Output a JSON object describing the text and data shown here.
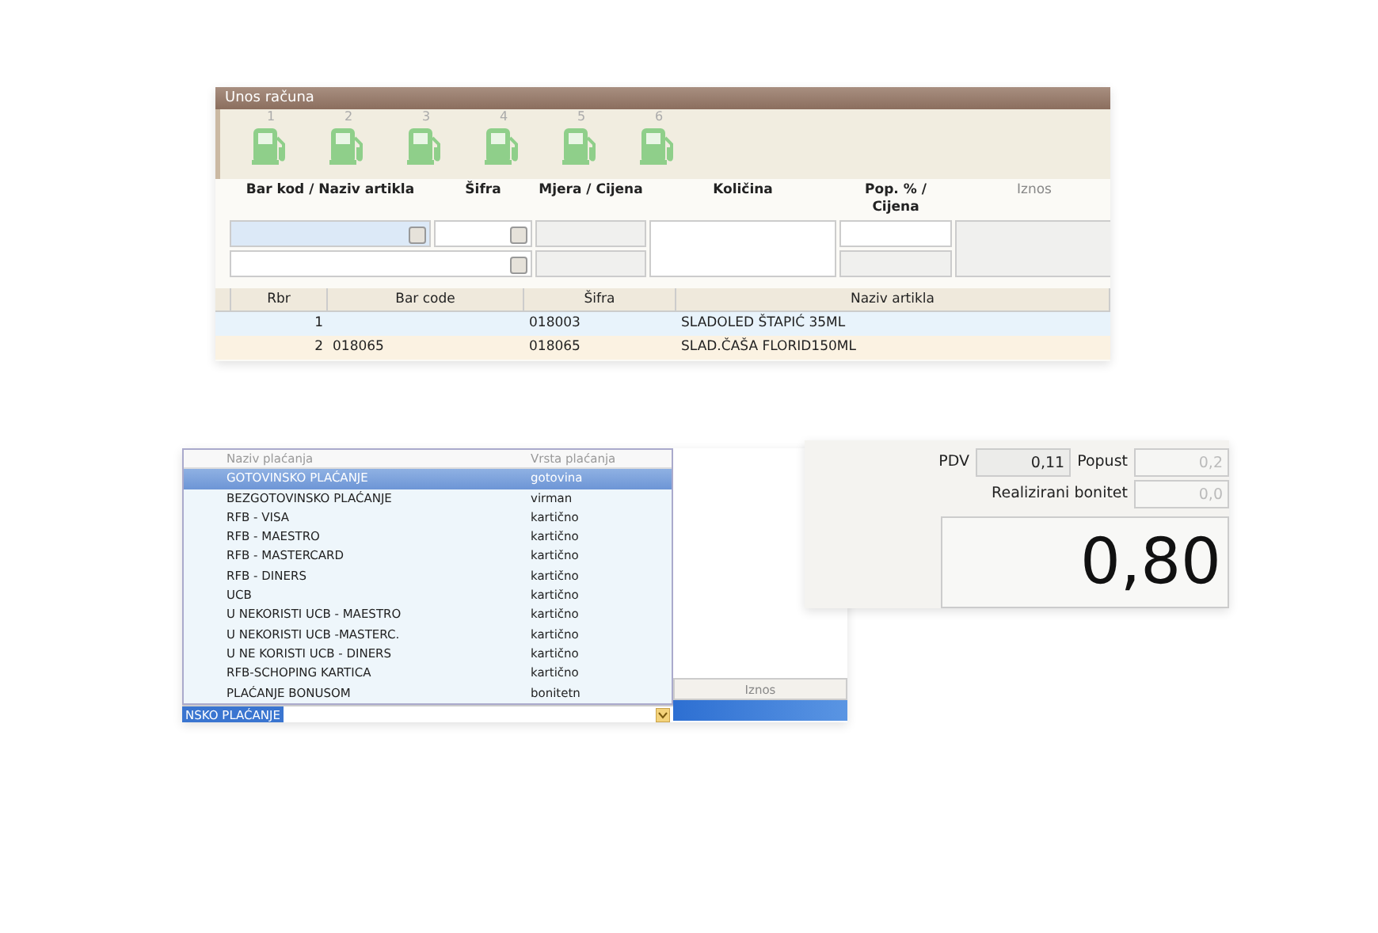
{
  "window": {
    "title": "Unos računa"
  },
  "pumps": [
    {
      "label": "1"
    },
    {
      "label": "2"
    },
    {
      "label": "3"
    },
    {
      "label": "4"
    },
    {
      "label": "5"
    },
    {
      "label": "6"
    }
  ],
  "entry_form": {
    "columns": [
      "Bar kod / Naziv artikla",
      "Šifra",
      "Mjera / Cijena",
      "Količina",
      "Pop. %  /  Cijena",
      "Iznos"
    ]
  },
  "items_table": {
    "columns": [
      "Rbr",
      "Bar code",
      "Šifra",
      "Naziv artikla"
    ],
    "rows": [
      {
        "rbr": "1",
        "sifra": "018003",
        "naziv": "SLADOLED ŠTAPIĆ 35ML",
        "selected": true
      },
      {
        "rbr": "2",
        "bar_code": "018065",
        "sifra": "018065",
        "naziv": "SLAD.ČAŠA FLORID150ML",
        "selected": false
      }
    ]
  },
  "payment_dropdown": {
    "columns": [
      "Naziv plaćanja",
      "Vrsta plaćanja"
    ],
    "options": [
      {
        "name": "GOTOVINSKO PLAĆANJE",
        "type": "gotovina",
        "selected": true
      },
      {
        "name": "BEZGOTOVINSKO PLAĆANJE",
        "type": "virman",
        "selected": false
      },
      {
        "name": "RFB - VISA",
        "type": "kartično",
        "selected": false
      },
      {
        "name": "RFB - MAESTRO",
        "type": "kartično",
        "selected": false
      },
      {
        "name": "RFB - MASTERCARD",
        "type": "kartično",
        "selected": false
      },
      {
        "name": "RFB - DINERS",
        "type": "kartično",
        "selected": false
      },
      {
        "name": "UCB",
        "type": "kartično",
        "selected": false
      },
      {
        "name": "U NEKORISTI UCB - MAESTRO",
        "type": "kartično",
        "selected": false
      },
      {
        "name": "U NEKORISTI UCB -MASTERC.",
        "type": "kartično",
        "selected": false
      },
      {
        "name": "U NE KORISTI UCB - DINERS",
        "type": "kartično",
        "selected": false
      },
      {
        "name": "RFB-SCHOPING KARTICA",
        "type": "kartično",
        "selected": false
      },
      {
        "name": "PLAĆANJE BONUSOM",
        "type": "bonitetn",
        "selected": false
      }
    ],
    "value": "NSKO PLAĆANJE"
  },
  "payments_table": {
    "columns": [
      "Iznos"
    ]
  },
  "totals": {
    "pdv_label": "PDV",
    "pdv": "0,11",
    "popust_label": "Popust",
    "popust": "0,2",
    "bonitet_label": "Realizirani bonitet",
    "bonitet": "0,0",
    "total": "0,80"
  }
}
